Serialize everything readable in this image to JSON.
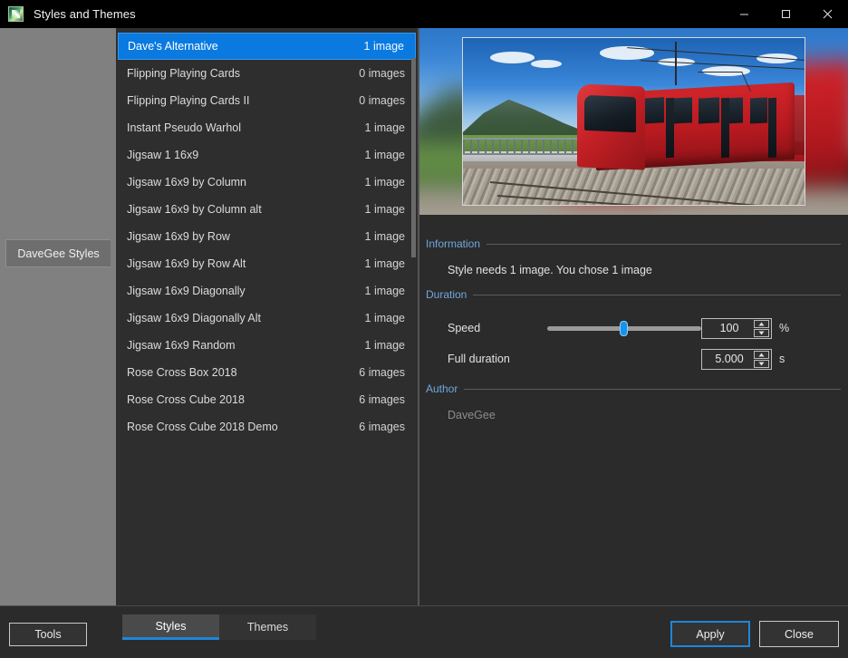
{
  "window": {
    "title": "Styles and Themes",
    "icon": "app-icon",
    "controls": {
      "minimize": "minimize-icon",
      "maximize": "maximize-icon",
      "close": "close-icon"
    }
  },
  "sidebar": {
    "tab_label": "DaveGee Styles"
  },
  "style_list": {
    "items": [
      {
        "name": "Dave's Alternative",
        "count": "1 image",
        "selected": true
      },
      {
        "name": "Flipping Playing Cards",
        "count": "0 images",
        "selected": false
      },
      {
        "name": "Flipping Playing Cards II",
        "count": "0 images",
        "selected": false
      },
      {
        "name": "Instant Pseudo Warhol",
        "count": "1 image",
        "selected": false
      },
      {
        "name": "Jigsaw 1 16x9",
        "count": "1 image",
        "selected": false
      },
      {
        "name": "Jigsaw 16x9 by Column",
        "count": "1 image",
        "selected": false
      },
      {
        "name": "Jigsaw 16x9 by Column alt",
        "count": "1 image",
        "selected": false
      },
      {
        "name": "Jigsaw 16x9 by Row",
        "count": "1 image",
        "selected": false
      },
      {
        "name": "Jigsaw 16x9 by Row Alt",
        "count": "1 image",
        "selected": false
      },
      {
        "name": "Jigsaw 16x9 Diagonally",
        "count": "1 image",
        "selected": false
      },
      {
        "name": "Jigsaw 16x9 Diagonally Alt",
        "count": "1 image",
        "selected": false
      },
      {
        "name": "Jigsaw 16x9 Random",
        "count": "1 image",
        "selected": false
      },
      {
        "name": "Rose Cross Box 2018",
        "count": "6 images",
        "selected": false
      },
      {
        "name": "Rose Cross Cube 2018",
        "count": "6 images",
        "selected": false
      },
      {
        "name": "Rose Cross Cube 2018 Demo",
        "count": "6 images",
        "selected": false
      }
    ]
  },
  "preview": {
    "image_description": "red tram on railway tracks with mountain landscape"
  },
  "information": {
    "title": "Information",
    "text": "Style needs 1 image. You chose 1 image"
  },
  "duration": {
    "title": "Duration",
    "speed_label": "Speed",
    "speed_value": "100",
    "speed_unit": "%",
    "speed_percent": 50,
    "full_duration_label": "Full duration",
    "full_duration_value": "5.000",
    "full_duration_unit": "s"
  },
  "author": {
    "title": "Author",
    "name": "DaveGee"
  },
  "bottom": {
    "tools_label": "Tools",
    "tabs": [
      {
        "label": "Styles",
        "active": true
      },
      {
        "label": "Themes",
        "active": false
      }
    ],
    "apply_label": "Apply",
    "close_label": "Close"
  },
  "colors": {
    "accent_blue": "#0a7ae0",
    "section_header_blue": "#6fa8dc",
    "window_bg": "#2b2b2b",
    "sidebar_gray": "#808080"
  }
}
